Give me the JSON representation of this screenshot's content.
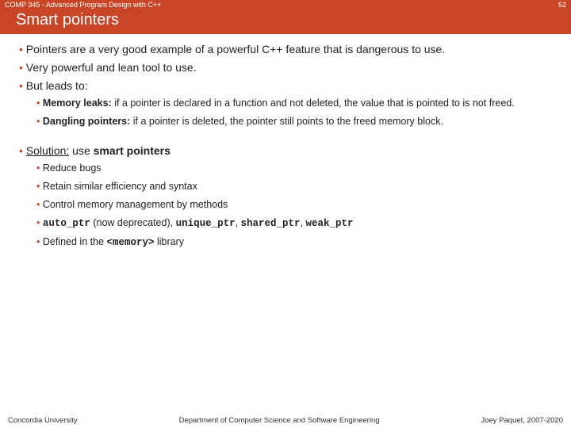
{
  "header": {
    "course": "COMP 345 - Advanced Program Design with C++",
    "slide_number": "52",
    "title": "Smart pointers"
  },
  "bullets": {
    "b1": "Pointers are a very good example of a powerful C++ feature that is dangerous to use.",
    "b2": "Very powerful and lean tool to use.",
    "b3": "But leads to:",
    "sub1_bold": "Memory leaks:",
    "sub1_rest": " if a pointer is declared in a function and not deleted, the value that is pointed to is not freed.",
    "sub2_bold": "Dangling pointers:",
    "sub2_rest": " if a pointer is deleted, the pointer still points to the freed memory block.",
    "sol_underline": "Solution:",
    "sol_mid": " use ",
    "sol_bold": "smart pointers",
    "s1": "Reduce bugs",
    "s2": "Retain similar efficiency and syntax",
    "s3": "Control memory management by methods",
    "s4_a": "auto_ptr",
    "s4_b": " (now deprecated), ",
    "s4_c": "unique_ptr",
    "s4_d": ", ",
    "s4_e": "shared_ptr",
    "s4_f": ", ",
    "s4_g": "weak_ptr",
    "s5_a": "Defined in the ",
    "s5_b": "<memory>",
    "s5_c": " library"
  },
  "footer": {
    "left": "Concordia University",
    "center": "Department of Computer Science and Software Engineering",
    "right": "Joey Paquet, 2007-2020"
  }
}
